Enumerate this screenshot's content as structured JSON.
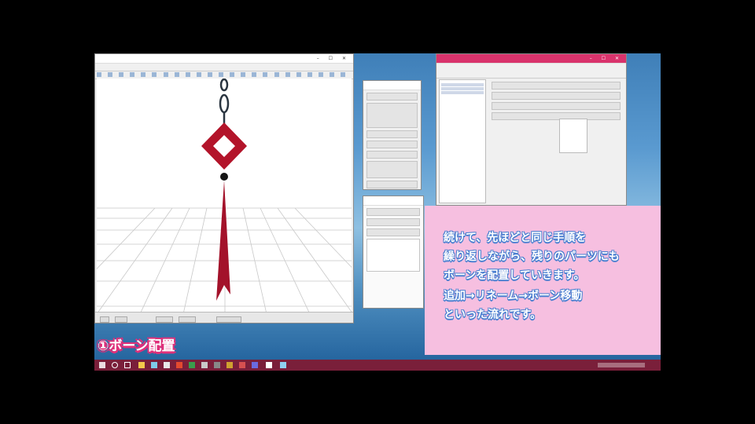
{
  "caption": {
    "lines": [
      "続けて、先ほどと同じ手順を",
      "繰り返しながら、残りのパーツにも",
      "ボーンを配置していきます。",
      "追加→リネーム→ボーン移動",
      "といった流れです。"
    ]
  },
  "section_label": "①ボーン配置",
  "colors": {
    "taskbar": "#7a1f3a",
    "caption_box": "#f6bfe0",
    "ornament_red": "#b3142a",
    "accent_title": "#e0307a"
  },
  "taskbar": {
    "icons": [
      "windows-icon",
      "search-icon",
      "task-view-icon",
      "explorer-icon",
      "app-icon",
      "app-icon",
      "app-icon",
      "app-icon",
      "app-icon",
      "app-icon",
      "app-icon",
      "app-icon",
      "app-icon",
      "app-icon"
    ]
  }
}
